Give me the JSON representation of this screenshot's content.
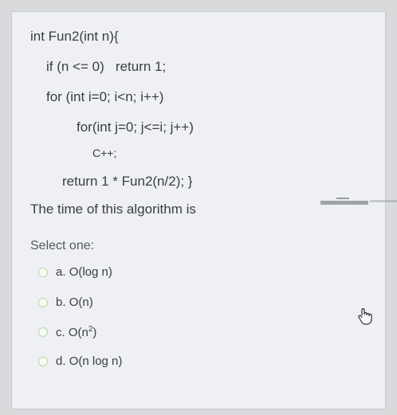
{
  "code": {
    "line1": "int Fun2(int n){",
    "line2": "if (n <= 0)   return 1;",
    "line3": "for (int i=0; i<n; i++)",
    "line4": "for(int j=0; j<=i; j++)",
    "line5": "C++;",
    "line6": "return 1 * Fun2(n/2); }"
  },
  "question": {
    "text": "The time of this algorithm is"
  },
  "select_label": "Select one:",
  "options": [
    {
      "letter": "a.",
      "text": "O(log n)"
    },
    {
      "letter": "b.",
      "text": "O(n)"
    },
    {
      "letter": "c.",
      "text_base": "O(n",
      "text_sup": "2",
      "text_end": ")"
    },
    {
      "letter": "d.",
      "text": "O(n log n)"
    }
  ],
  "colors": {
    "panel_bg": "#eef0f3",
    "text": "#3a3d42",
    "radio_border": "#b8d8a8"
  },
  "icons": {
    "cursor": "hand-pointer-icon"
  }
}
